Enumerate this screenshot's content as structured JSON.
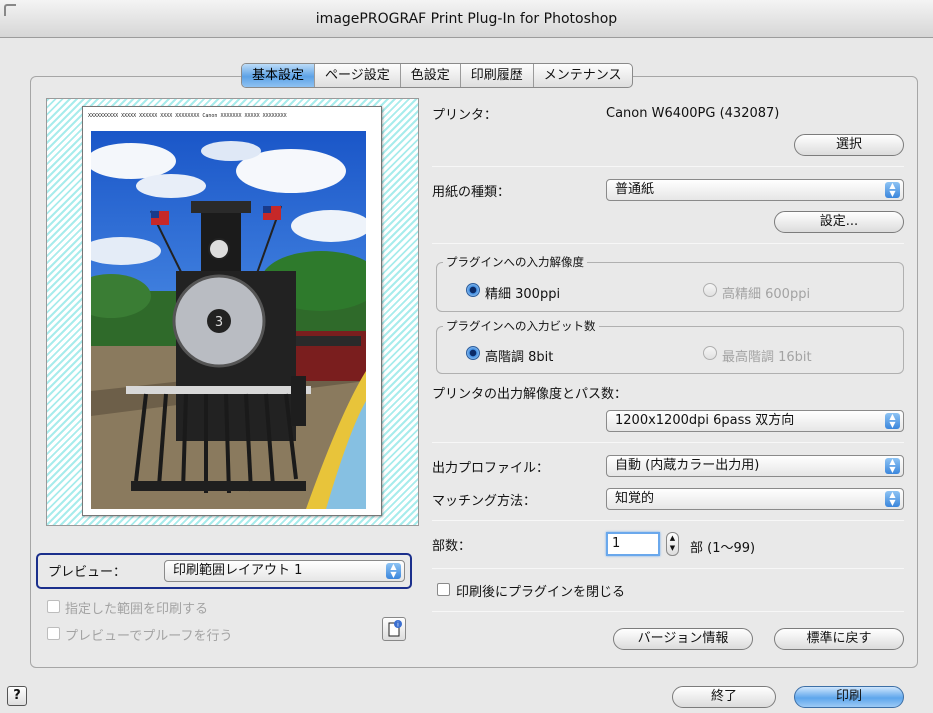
{
  "window": {
    "title": "imagePROGRAF Print Plug-In for Photoshop"
  },
  "tabs": [
    {
      "label": "基本設定",
      "active": true
    },
    {
      "label": "ページ設定",
      "active": false
    },
    {
      "label": "色設定",
      "active": false
    },
    {
      "label": "印刷履歴",
      "active": false
    },
    {
      "label": "メンテナンス",
      "active": false
    }
  ],
  "preview_header_text": "XXXXXXXXXX XXXXX XXXXXX XXXX XXXXXXXX Canon XXXXXXX XXXXX XXXXXXXX",
  "printer": {
    "label": "プリンタ：",
    "name": "Canon W6400PG (432087)",
    "select_button": "選択"
  },
  "media": {
    "label": "用紙の種類：",
    "value": "普通紙",
    "settings_button": "設定..."
  },
  "input_resolution": {
    "title": "プラグインへの入力解像度",
    "options": [
      {
        "label": "精細 300ppi",
        "selected": true,
        "enabled": true
      },
      {
        "label": "高精細 600ppi",
        "selected": false,
        "enabled": false
      }
    ]
  },
  "input_bit_depth": {
    "title": "プラグインへの入力ビット数",
    "options": [
      {
        "label": "高階調 8bit",
        "selected": true,
        "enabled": true
      },
      {
        "label": "最高階調 16bit",
        "selected": false,
        "enabled": false
      }
    ]
  },
  "output_resolution": {
    "label": "プリンタの出力解像度とパス数：",
    "value": "1200x1200dpi 6pass 双方向"
  },
  "output_profile": {
    "label": "出力プロファイル：",
    "value": "自動 (内蔵カラー出力用)"
  },
  "matching": {
    "label": "マッチング方法：",
    "value": "知覚的"
  },
  "copies": {
    "label": "部数：",
    "value": "1",
    "suffix": "部 (1〜99)"
  },
  "close_after_print": {
    "label": "印刷後にプラグインを閉じる",
    "checked": false
  },
  "preview": {
    "label": "プレビュー：",
    "value": "印刷範囲レイアウト 1",
    "print_selected_range": {
      "label": "指定した範囲を印刷する",
      "checked": false,
      "enabled": false
    },
    "proof_in_preview": {
      "label": "プレビューでプルーフを行う",
      "checked": false,
      "enabled": false
    }
  },
  "buttons": {
    "version_info": "バージョン情報",
    "defaults": "標準に戻す",
    "close": "終了",
    "print": "印刷"
  },
  "help_glyph": "?",
  "icons": {
    "help": "help-icon",
    "info": "document-info-icon",
    "popup_arrow": "updown-arrow-icon"
  },
  "colors": {
    "accent": "#5da2e6",
    "preview_stripe": "#a8ecec",
    "focus_ring": "#1b2f8c"
  }
}
